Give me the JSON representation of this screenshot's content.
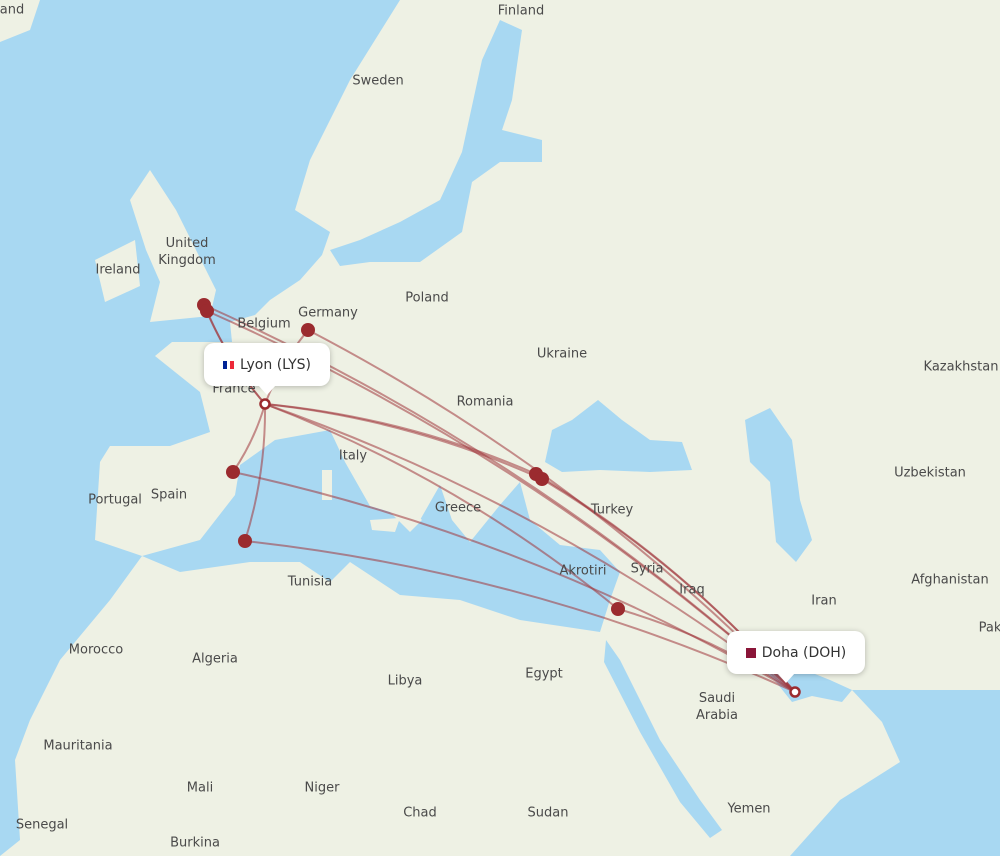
{
  "origin": {
    "label": "Lyon (LYS)",
    "flag": "france-flag"
  },
  "destination": {
    "label": "Doha (DOH)",
    "flag": "qatar-flag"
  },
  "colors": {
    "water": "#a8d8f2",
    "land": "#eef1e4",
    "route": "#a0373c",
    "airport": "#9b2b2f",
    "border": "#a9cda0"
  },
  "map_labels": {
    "iceland": "and",
    "finland": "Finland",
    "sweden": "Sweden",
    "united_kingdom": "United\nKingdom",
    "ireland": "Ireland",
    "belgium": "Belgium",
    "germany": "Germany",
    "poland": "Poland",
    "ukraine": "Ukraine",
    "france": "France",
    "romania": "Romania",
    "kazakhstan": "Kazakhstan",
    "italy": "Italy",
    "uzbekistan": "Uzbekistan",
    "portugal": "Portugal",
    "spain": "Spain",
    "greece": "Greece",
    "turkey": "Turkey",
    "akrotiri": "Akrotiri",
    "syria": "Syria",
    "iraq": "Iraq",
    "tunisia": "Tunisia",
    "afghanistan": "Afghanistan",
    "iran": "Iran",
    "pakistan": "Pak",
    "morocco": "Morocco",
    "algeria": "Algeria",
    "libya": "Libya",
    "egypt": "Egypt",
    "saudi_arabia": "Saudi\nArabia",
    "mauritania": "Mauritania",
    "mali": "Mali",
    "niger": "Niger",
    "chad": "Chad",
    "sudan": "Sudan",
    "yemen": "Yemen",
    "senegal": "Senegal",
    "burkina": "Burkina"
  }
}
